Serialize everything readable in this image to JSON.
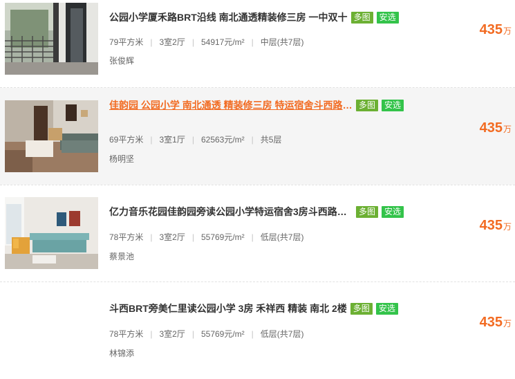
{
  "listings": [
    {
      "title": "公园小学厦禾路BRT沿线 南北通透精装修三房 一中双十",
      "tags": [
        "多图",
        "安选"
      ],
      "area": "79平方米",
      "layout": "3室2厅",
      "unit_price": "54917元/m²",
      "floor": "中层(共7层)",
      "agent": "张俊辉",
      "price": "435",
      "price_unit": "万"
    },
    {
      "title": "佳韵园 公园小学 南北通透 精装修三房 特运宿舍斗西路B...",
      "tags": [
        "多图",
        "安选"
      ],
      "area": "69平方米",
      "layout": "3室1厅",
      "unit_price": "62563元/m²",
      "floor": "共5层",
      "agent": "杨明坚",
      "price": "435",
      "price_unit": "万"
    },
    {
      "title": "亿力音乐花园佳韵园旁读公园小学特运宿舍3房斗西路BR...",
      "tags": [
        "多图",
        "安选"
      ],
      "area": "78平方米",
      "layout": "3室2厅",
      "unit_price": "55769元/m²",
      "floor": "低层(共7层)",
      "agent": "蔡景池",
      "price": "435",
      "price_unit": "万"
    },
    {
      "title": "斗西BRT旁美仁里读公园小学 3房 禾祥西 精装 南北 2楼",
      "tags": [
        "多图",
        "安选"
      ],
      "area": "78平方米",
      "layout": "3室2厅",
      "unit_price": "55769元/m²",
      "floor": "低层(共7层)",
      "agent": "林锦添",
      "price": "435",
      "price_unit": "万"
    }
  ]
}
